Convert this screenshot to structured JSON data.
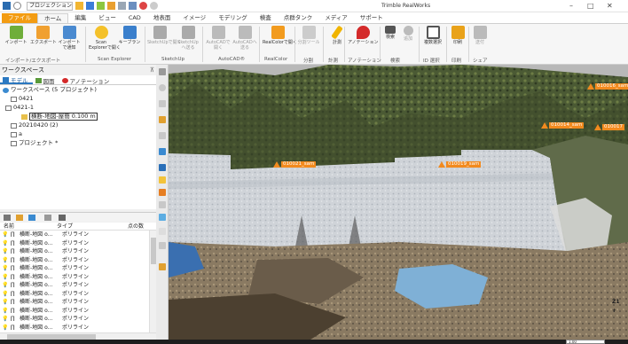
{
  "titlebar": {
    "project_combo": "プロジェクションン",
    "app_title": "Trimble RealWorks",
    "minimize": "–",
    "maximize": "□",
    "close": "✕"
  },
  "ribbon_tabs": [
    "ファイル",
    "ホーム",
    "編集",
    "ビュー",
    "CAD",
    "地表面",
    "イメージ",
    "モデリング",
    "検査",
    "点群タンク",
    "メディア",
    "サポート"
  ],
  "ribbon": {
    "buttons": [
      {
        "label1": "インポート",
        "label2": "",
        "dim": false
      },
      {
        "label1": "エクスポート",
        "label2": "",
        "dim": false
      },
      {
        "label1": "インポート",
        "label2": "で通知",
        "dim": false
      },
      {
        "label1": "Scan",
        "label2": "Explorerで開く",
        "dim": false
      },
      {
        "label1": "キーブラン",
        "label2": "",
        "dim": false
      },
      {
        "label1": "SketchUpで開く",
        "label2": "",
        "dim": true
      },
      {
        "label1": "SketchUp",
        "label2": "へ送る",
        "dim": true
      },
      {
        "label1": "AutoCADで",
        "label2": "開く",
        "dim": true
      },
      {
        "label1": "AutoCADへ",
        "label2": "送る",
        "dim": true
      },
      {
        "label1": "RealColorで開く",
        "label2": "",
        "dim": false
      },
      {
        "label1": "分割ツール",
        "label2": "",
        "dim": true
      },
      {
        "label1": "計測",
        "label2": "",
        "dim": false
      },
      {
        "label1": "アノテーション",
        "label2": "",
        "dim": false
      },
      {
        "label1": "検索",
        "label2": "",
        "dim": false
      },
      {
        "label1": "追加",
        "label2": "",
        "dim": true
      },
      {
        "label1": "複数選択",
        "label2": "",
        "dim": false
      },
      {
        "label1": "印刷",
        "label2": "",
        "dim": false
      },
      {
        "label1": "送付",
        "label2": "",
        "dim": true
      }
    ],
    "groups": [
      "インポート/エクスポート",
      "Scan Explorer",
      "SketchUp",
      "AutoCAD®",
      "RealColor",
      "分割",
      "計測",
      "アノテーション",
      "検索",
      "ID 選択",
      "印刷",
      "シェア"
    ]
  },
  "workspace": {
    "title": "ワークスペース",
    "pin": "⊼",
    "tabs": [
      "モデル",
      "図面",
      "アノテーション"
    ],
    "tree": [
      {
        "text": "ワークスペース (5 プロジェクト)",
        "level": 0
      },
      {
        "text": "0421",
        "level": 1
      },
      {
        "text": "0421-1",
        "level": 1
      },
      {
        "text": "横断-地図-屋簡 0.100 m",
        "level": 2
      },
      {
        "text": "20210420 (2)",
        "level": 1
      },
      {
        "text": "a",
        "level": 1
      },
      {
        "text": "プロジェクト *",
        "level": 1
      }
    ]
  },
  "list_panel": {
    "columns": [
      "名前",
      "タイプ",
      "点の数"
    ],
    "rows": [
      {
        "name": "横断-地図 o...",
        "type": "ポリライン"
      },
      {
        "name": "横断-地図 o...",
        "type": "ポリライン"
      },
      {
        "name": "横断-地図 o...",
        "type": "ポリライン"
      },
      {
        "name": "横断-地図 o...",
        "type": "ポリライン"
      },
      {
        "name": "横断-地図 o...",
        "type": "ポリライン"
      },
      {
        "name": "横断-地図 o...",
        "type": "ポリライン"
      },
      {
        "name": "横断-地図 o...",
        "type": "ポリライン"
      },
      {
        "name": "横断-地図 o...",
        "type": "ポリライン"
      },
      {
        "name": "横断-地図 o...",
        "type": "ポリライン"
      },
      {
        "name": "横断-地図 o...",
        "type": "ポリライン"
      },
      {
        "name": "横断-地図 o...",
        "type": "ポリライン"
      },
      {
        "name": "横断-地図 o...",
        "type": "ポリライン"
      }
    ]
  },
  "viewport": {
    "markers": [
      "010016_sam",
      "010014_sam",
      "010017",
      "010021_sam",
      "010019_sam"
    ],
    "axis_label": "Z1",
    "axis_label2": "+"
  },
  "statusbar": {
    "right_text": "1.00"
  },
  "colors": {
    "accent_orange": "#f28a1e",
    "file_tab": "#f39c12",
    "selection_blue": "#2b79c2"
  }
}
